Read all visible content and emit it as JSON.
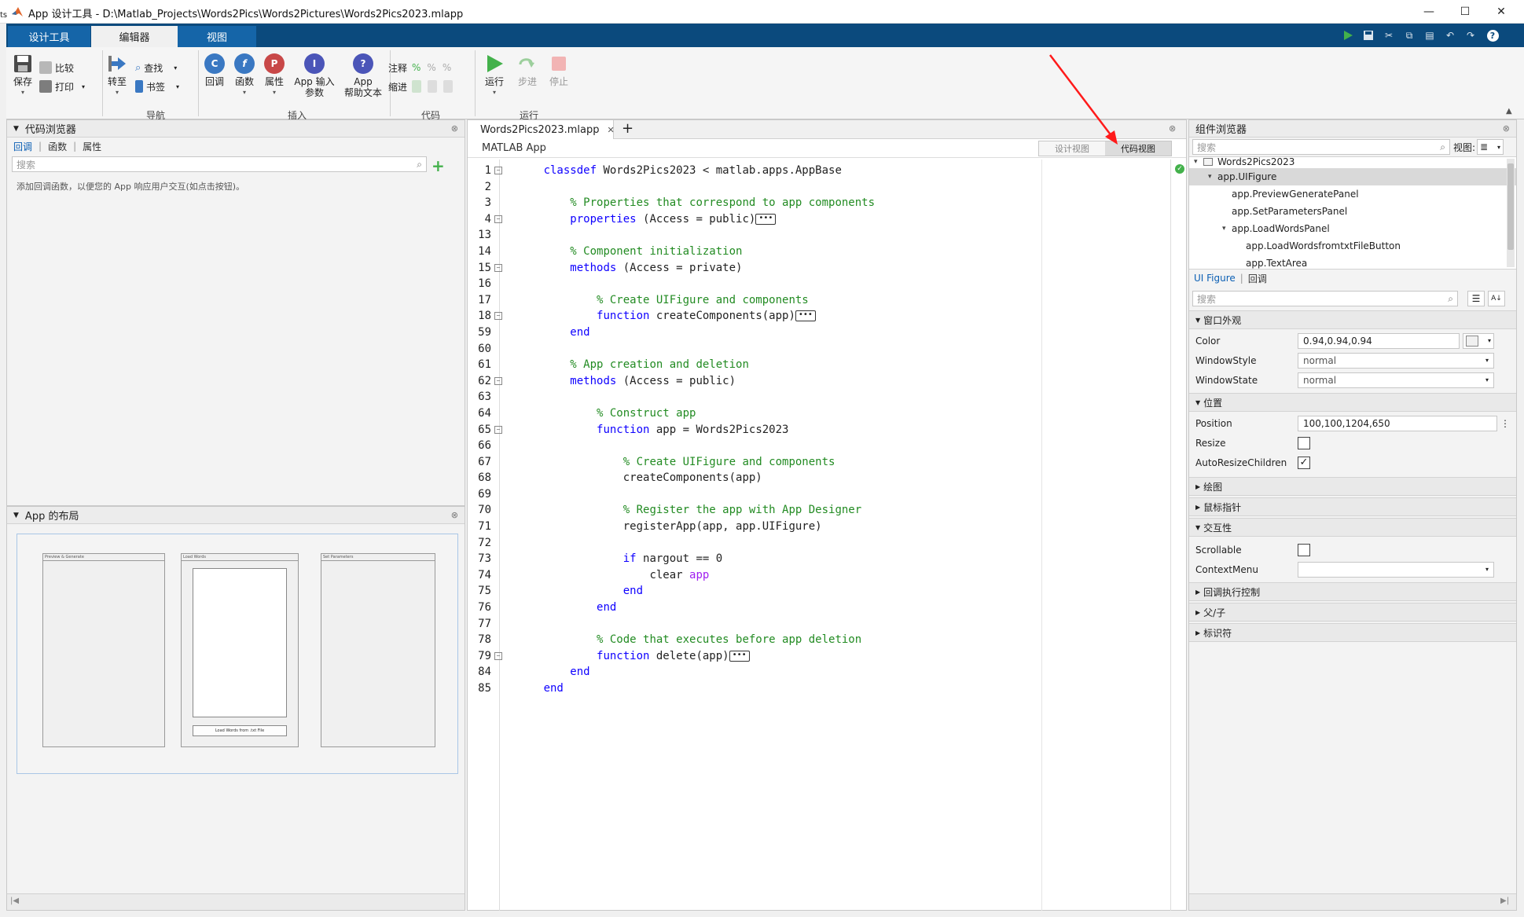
{
  "window": {
    "title": "App 设计工具 - D:\\Matlab_Projects\\Words2Pics\\Words2Pictures\\Words2Pics2023.mlapp",
    "minimize": "—",
    "maximize": "☐",
    "close": "✕"
  },
  "left_edge": {
    "label": "ts"
  },
  "ribbon_tabs": {
    "designer": "设计工具",
    "editor": "编辑器",
    "view": "视图"
  },
  "ribbon": {
    "save": "保存",
    "compare": "比较",
    "print": "打印",
    "goto": "转至",
    "find": "查找",
    "bookmark": "书签",
    "callback": "回调",
    "function": "函数",
    "property": "属性",
    "app_input_1": "App 输入",
    "app_input_2": "参数",
    "app_help_1": "App",
    "app_help_2": "帮助文本",
    "comment": "注释",
    "indent": "缩进",
    "run": "运行",
    "step": "步进",
    "stop": "停止",
    "group_nav": "导航",
    "group_insert": "插入",
    "group_code": "代码",
    "group_run": "运行"
  },
  "code_browser": {
    "title": "代码浏览器",
    "tabs": [
      "回调",
      "函数",
      "属性"
    ],
    "search_placeholder": "搜索",
    "hint": "添加回调函数，以便您的 App 响应用户交互(如点击按钮)。"
  },
  "app_layout": {
    "title": "App 的布局",
    "panel1": "Preview & Generate",
    "panel2": "Load Words",
    "panel3": "Set Parameters",
    "button": "Load Words from .txt File"
  },
  "editor": {
    "tab_label": "Words2Pics2023.mlapp",
    "subtitle": "MATLAB App",
    "design_view": "设计视图",
    "code_view": "代码视图",
    "lines": [
      {
        "n": "1",
        "f": true,
        "t": [
          [
            "kw",
            "classdef "
          ],
          [
            "",
            "Words2Pics2023 < matlab.apps.AppBase"
          ]
        ]
      },
      {
        "n": "2",
        "t": []
      },
      {
        "n": "3",
        "t": [
          [
            "",
            "    "
          ],
          [
            "cm",
            "% Properties that correspond to app components"
          ]
        ]
      },
      {
        "n": "4",
        "f": true,
        "e": true,
        "t": [
          [
            "",
            "    "
          ],
          [
            "kw",
            "properties"
          ],
          [
            "",
            " (Access = public)"
          ]
        ]
      },
      {
        "n": "13",
        "t": []
      },
      {
        "n": "14",
        "t": [
          [
            "",
            "    "
          ],
          [
            "cm",
            "% Component initialization"
          ]
        ]
      },
      {
        "n": "15",
        "f": true,
        "t": [
          [
            "",
            "    "
          ],
          [
            "kw",
            "methods"
          ],
          [
            "",
            " (Access = private)"
          ]
        ]
      },
      {
        "n": "16",
        "t": []
      },
      {
        "n": "17",
        "t": [
          [
            "",
            "        "
          ],
          [
            "cm",
            "% Create UIFigure and components"
          ]
        ]
      },
      {
        "n": "18",
        "f": true,
        "e": true,
        "t": [
          [
            "",
            "        "
          ],
          [
            "kw",
            "function"
          ],
          [
            "",
            " createComponents(app)"
          ]
        ]
      },
      {
        "n": "59",
        "t": [
          [
            "",
            "    "
          ],
          [
            "kw",
            "end"
          ]
        ]
      },
      {
        "n": "60",
        "t": []
      },
      {
        "n": "61",
        "t": [
          [
            "",
            "    "
          ],
          [
            "cm",
            "% App creation and deletion"
          ]
        ]
      },
      {
        "n": "62",
        "f": true,
        "t": [
          [
            "",
            "    "
          ],
          [
            "kw",
            "methods"
          ],
          [
            "",
            " (Access = public)"
          ]
        ]
      },
      {
        "n": "63",
        "t": []
      },
      {
        "n": "64",
        "t": [
          [
            "",
            "        "
          ],
          [
            "cm",
            "% Construct app"
          ]
        ]
      },
      {
        "n": "65",
        "f": true,
        "t": [
          [
            "",
            "        "
          ],
          [
            "kw",
            "function"
          ],
          [
            "",
            " app = Words2Pics2023"
          ]
        ]
      },
      {
        "n": "66",
        "t": []
      },
      {
        "n": "67",
        "t": [
          [
            "",
            "            "
          ],
          [
            "cm",
            "% Create UIFigure and components"
          ]
        ]
      },
      {
        "n": "68",
        "t": [
          [
            "",
            "            createComponents(app)"
          ]
        ]
      },
      {
        "n": "69",
        "t": []
      },
      {
        "n": "70",
        "t": [
          [
            "",
            "            "
          ],
          [
            "cm",
            "% Register the app with App Designer"
          ]
        ]
      },
      {
        "n": "71",
        "t": [
          [
            "",
            "            registerApp(app, app.UIFigure)"
          ]
        ]
      },
      {
        "n": "72",
        "t": []
      },
      {
        "n": "73",
        "t": [
          [
            "",
            "            "
          ],
          [
            "kw",
            "if"
          ],
          [
            "",
            " nargout == 0"
          ]
        ]
      },
      {
        "n": "74",
        "t": [
          [
            "",
            "                clear "
          ],
          [
            "pu",
            "app"
          ]
        ]
      },
      {
        "n": "75",
        "t": [
          [
            "",
            "            "
          ],
          [
            "kw",
            "end"
          ]
        ]
      },
      {
        "n": "76",
        "t": [
          [
            "",
            "        "
          ],
          [
            "kw",
            "end"
          ]
        ]
      },
      {
        "n": "77",
        "t": []
      },
      {
        "n": "78",
        "t": [
          [
            "",
            "        "
          ],
          [
            "cm",
            "% Code that executes before app deletion"
          ]
        ]
      },
      {
        "n": "79",
        "f": true,
        "e": true,
        "t": [
          [
            "",
            "        "
          ],
          [
            "kw",
            "function"
          ],
          [
            "",
            " delete(app)"
          ]
        ]
      },
      {
        "n": "84",
        "t": [
          [
            "",
            "    "
          ],
          [
            "kw",
            "end"
          ]
        ]
      },
      {
        "n": "85",
        "t": [
          [
            "kw",
            "end"
          ]
        ]
      }
    ],
    "ellipsis": "•••"
  },
  "component_browser": {
    "title": "组件浏览器",
    "search_placeholder": "搜索",
    "view_label": "视图:",
    "tree": [
      {
        "label": "Words2Pics2023",
        "indent": 0,
        "arrow": "▾"
      },
      {
        "label": "app.UIFigure",
        "indent": 1,
        "arrow": "▾",
        "selected": true
      },
      {
        "label": "app.PreviewGeneratePanel",
        "indent": 2,
        "arrow": ""
      },
      {
        "label": "app.SetParametersPanel",
        "indent": 2,
        "arrow": ""
      },
      {
        "label": "app.LoadWordsPanel",
        "indent": 2,
        "arrow": "▾"
      },
      {
        "label": "app.LoadWordsfromtxtFileButton",
        "indent": 3,
        "arrow": ""
      },
      {
        "label": "app.TextArea",
        "indent": 3,
        "arrow": ""
      }
    ],
    "inspector_tabs": [
      "UI Figure",
      "回调"
    ],
    "inspector_search": "搜索",
    "sections": {
      "appearance": "窗口外观",
      "position": "位置",
      "plotting": "绘图",
      "pointer": "鼠标指针",
      "interactivity": "交互性",
      "callback_exec": "回调执行控制",
      "parent_child": "父/子",
      "identifiers": "标识符"
    },
    "props": {
      "color_label": "Color",
      "color_value": "0.94,0.94,0.94",
      "windowstyle_label": "WindowStyle",
      "windowstyle_value": "normal",
      "windowstate_label": "WindowState",
      "windowstate_value": "normal",
      "position_label": "Position",
      "position_value": "100,100,1204,650",
      "resize_label": "Resize",
      "resize_checked": false,
      "autoresize_label": "AutoResizeChildren",
      "autoresize_checked": true,
      "scrollable_label": "Scrollable",
      "scrollable_checked": false,
      "contextmenu_label": "ContextMenu",
      "contextmenu_value": ""
    }
  },
  "colors": {
    "accent": "#0b4a7d",
    "annotation_arrow": "#ff1a1a",
    "keyword": "#0e00ff",
    "comment": "#228b22"
  }
}
